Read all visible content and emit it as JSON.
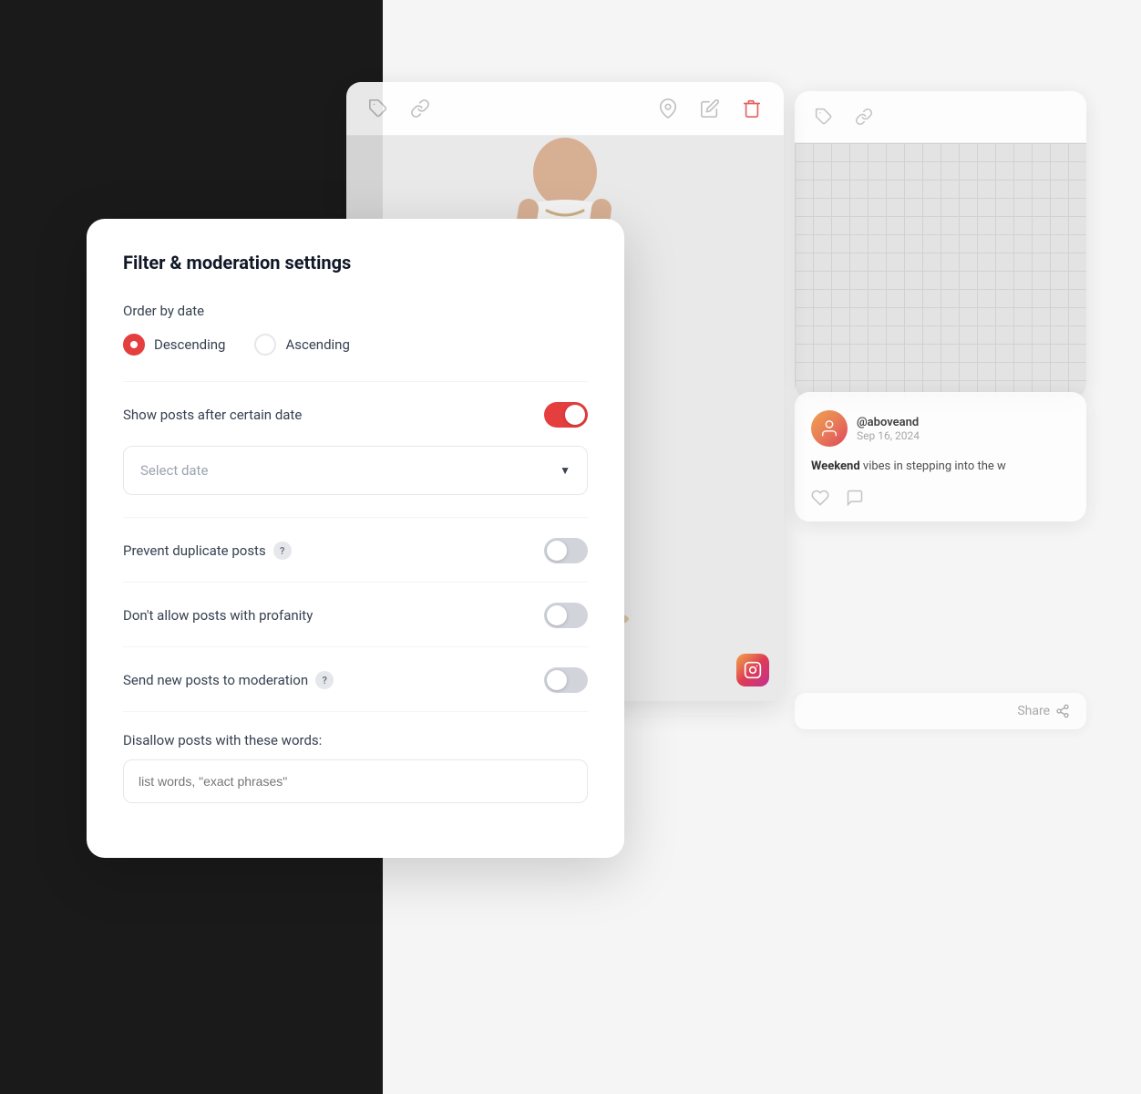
{
  "background": {
    "dark_color": "#1a1a1a",
    "light_color": "#f5f5f5"
  },
  "card_center": {
    "toolbar": {
      "icons": [
        "tag",
        "link",
        "pin",
        "edit",
        "trash"
      ]
    },
    "image_alt": "Fashion photo - woman in white top and blue jeans"
  },
  "card_social": {
    "username": "@aboveand",
    "date": "Sep 16, 2024",
    "text_start": "Weekend",
    "text_middle": " vibes in",
    "text_end": " stepping into the w",
    "actions": [
      "heart",
      "comment"
    ]
  },
  "card_share": {
    "label": "Share"
  },
  "filter_modal": {
    "title": "Filter & moderation settings",
    "order_section": {
      "label": "Order by date",
      "options": [
        {
          "id": "descending",
          "label": "Descending",
          "selected": true
        },
        {
          "id": "ascending",
          "label": "Ascending",
          "selected": false
        }
      ]
    },
    "show_posts_toggle": {
      "label": "Show posts after certain date",
      "enabled": true
    },
    "date_select": {
      "placeholder": "Select date",
      "value": ""
    },
    "prevent_duplicate": {
      "label": "Prevent duplicate posts",
      "has_help": true,
      "enabled": false
    },
    "no_profanity": {
      "label": "Don't allow posts with profanity",
      "has_help": false,
      "enabled": false
    },
    "send_to_moderation": {
      "label": "Send new posts to moderation",
      "has_help": true,
      "enabled": false
    },
    "disallow_words": {
      "label": "Disallow posts with these words:",
      "placeholder": "list words, \"exact phrases\""
    }
  }
}
